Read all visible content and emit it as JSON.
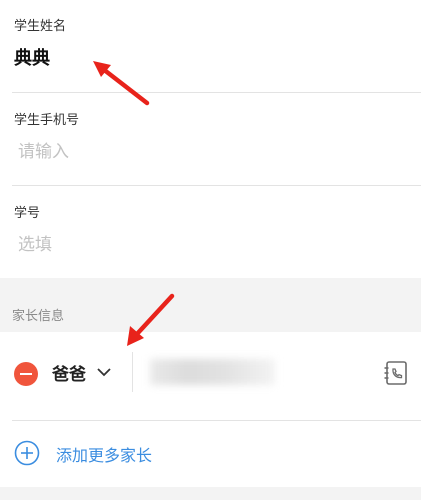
{
  "form": {
    "student_name": {
      "label": "学生姓名",
      "value": "典典"
    },
    "student_phone": {
      "label": "学生手机号",
      "placeholder": "请输入"
    },
    "student_id": {
      "label": "学号",
      "placeholder": "选填"
    }
  },
  "parent_section": {
    "title": "家长信息",
    "parents": [
      {
        "relation": "爸爸"
      }
    ],
    "add_more_label": "添加更多家长"
  },
  "colors": {
    "remove": "#f0553c",
    "link": "#3b8de0",
    "annotation_arrow": "#e8231b"
  }
}
